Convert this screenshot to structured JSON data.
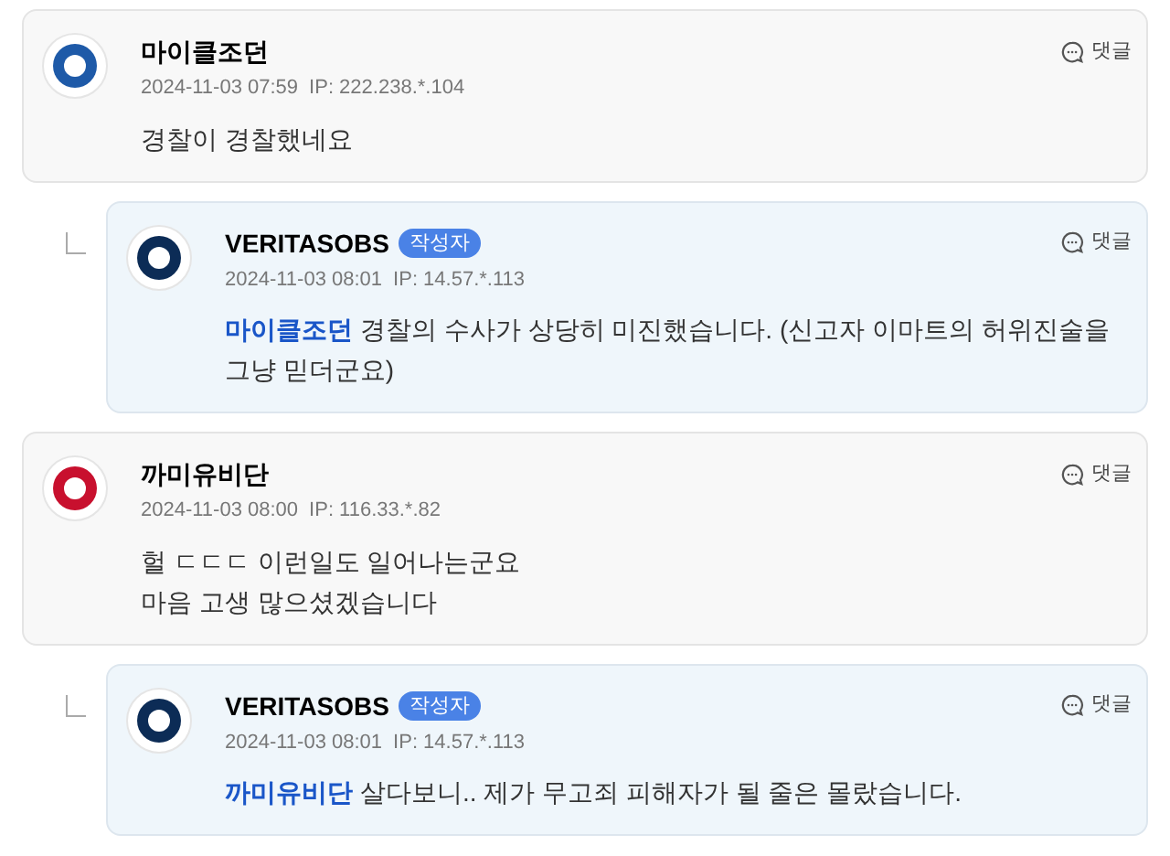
{
  "comments": [
    {
      "kind": "comment",
      "author": "마이클조던",
      "date": "2024-11-03 07:59",
      "ip": "IP: 222.238.*.104",
      "body": "경찰이 경찰했네요",
      "reply_label": "댓글",
      "color": "#1e5aa8"
    },
    {
      "kind": "reply",
      "author": "VERITASOBS",
      "author_badge": "작성자",
      "date": "2024-11-03 08:01",
      "ip": "IP: 14.57.*.113",
      "mention": "마이클조던",
      "body": "경찰의 수사가 상당히 미진했습니다. (신고자 이마트의 허위진술을 그냥 믿더군요)",
      "reply_label": "댓글",
      "color": "#0c2c56"
    },
    {
      "kind": "comment",
      "author": "까미유비단",
      "date": "2024-11-03 08:00",
      "ip": "IP: 116.33.*.82",
      "body": "헐 ㄷㄷㄷ 이런일도 일어나는군요\n마음 고생 많으셨겠습니다",
      "reply_label": "댓글",
      "color": "#c8102e"
    },
    {
      "kind": "reply",
      "author": "VERITASOBS",
      "author_badge": "작성자",
      "date": "2024-11-03 08:01",
      "ip": "IP: 14.57.*.113",
      "mention": "까미유비단",
      "body": "살다보니.. 제가 무고죄 피해자가 될 줄은 몰랐습니다.",
      "reply_label": "댓글",
      "color": "#0c2c56"
    }
  ]
}
